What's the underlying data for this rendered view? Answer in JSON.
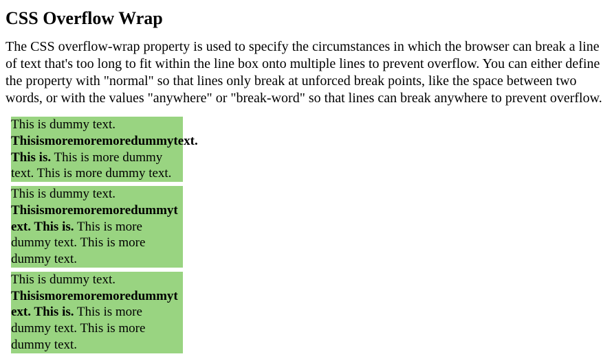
{
  "heading": "CSS Overflow Wrap",
  "description": "The CSS overflow-wrap property is used to specify the circumstances in which the browser can break a line of text that's too long to fit within the line box onto multiple lines to prevent overflow. You can either define the property with \"normal\" so that lines only break at unforced break points, like the space between two words, or with the values \"anywhere\" or \"break-word\" so that lines can break anywhere to prevent overflow.",
  "examples": [
    {
      "lead": "This is dummy text. ",
      "bold": "Thisismoremoremoredummytext. This is.",
      "tail": " This is more dummy text. This is more dummy text."
    },
    {
      "lead": "This is dummy text. ",
      "bold": "Thisismoremoremoredummytext. This is.",
      "tail": " This is more dummy text. This is more dummy text."
    },
    {
      "lead": "This is dummy text. ",
      "bold": "Thisismoremoremoredummytext. This is.",
      "tail": " This is more dummy text. This is more dummy text."
    }
  ]
}
